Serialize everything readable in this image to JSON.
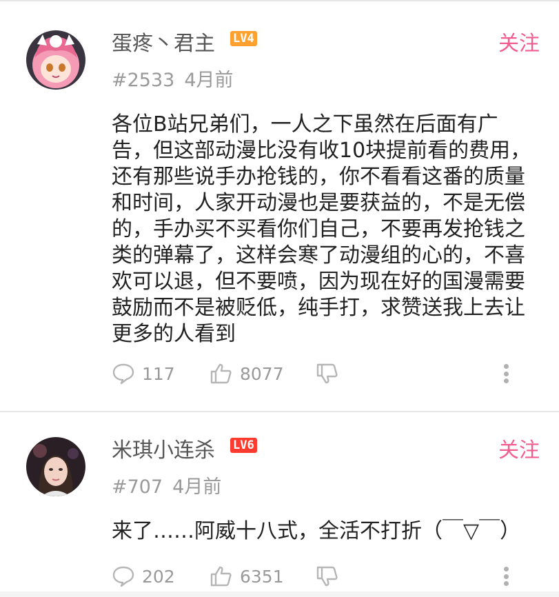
{
  "comments": [
    {
      "username": "蛋疼丶君主",
      "level": "LV4",
      "level_color": "#ffa02f",
      "follow_label": "关注",
      "floor": "#2533",
      "time": "4月前",
      "content": "各位B站兄弟们，一人之下虽然在后面有广告，但这部动漫比没有收10块提前看的费用，还有那些说手办抢钱的，你不看看这番的质量和时间，人家开动漫也是要获益的，不是无偿的，手办买不买看你们自己，不要再发抢钱之类的弹幕了，这样会寒了动漫组的心的，不喜欢可以退，但不要喷，因为现在好的国漫需要鼓励而不是被贬低，纯手打，求赞送我上去让更多的人看到",
      "reply_count": "117",
      "like_count": "8077"
    },
    {
      "username": "米琪小连杀",
      "level": "LV6",
      "level_color": "#ff3b30",
      "follow_label": "关注",
      "floor": "#707",
      "time": "4月前",
      "content": "来了……阿威十八式，全活不打折（￣▽￣）",
      "reply_count": "202",
      "like_count": "6351"
    }
  ],
  "icons": {
    "reply": "speech-bubble-icon",
    "like": "thumbs-up-icon",
    "dislike": "thumbs-down-icon",
    "more": "more-vertical-icon"
  },
  "colors": {
    "accent": "#f25d8e",
    "text": "#212121",
    "muted": "#999999"
  }
}
